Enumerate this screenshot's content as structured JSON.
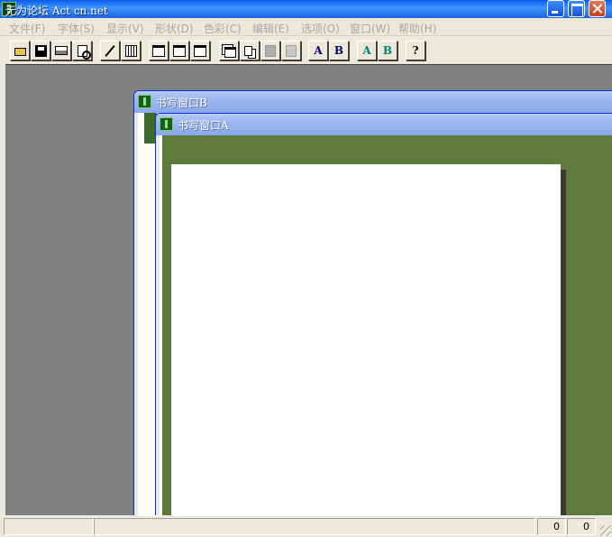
{
  "window": {
    "title": "无为论坛 Act cn.net"
  },
  "menu": [
    {
      "label": "文件(F)"
    },
    {
      "label": "字体(S)"
    },
    {
      "label": "显示(V)"
    },
    {
      "label": "形状(D)"
    },
    {
      "label": "色彩(C)"
    },
    {
      "label": "编辑(E)"
    },
    {
      "label": "选项(O)"
    },
    {
      "label": "窗口(W)"
    },
    {
      "label": "帮助(H)"
    }
  ],
  "toolbar": {
    "font_a_label": "A",
    "font_b_label": "B",
    "color_a_label": "A",
    "color_b_label": "B",
    "help_label": "?"
  },
  "children": {
    "window_b": {
      "title": "书写窗口B"
    },
    "window_a": {
      "title": "书写窗口A"
    }
  },
  "status": {
    "value_1": "0",
    "value_2": "0"
  },
  "colors": {
    "title_blue": "#0a5ee8",
    "mdi_background": "#808080",
    "canvas_green": "#5e7a3d",
    "menu_disabled": "#a7a6aa"
  }
}
